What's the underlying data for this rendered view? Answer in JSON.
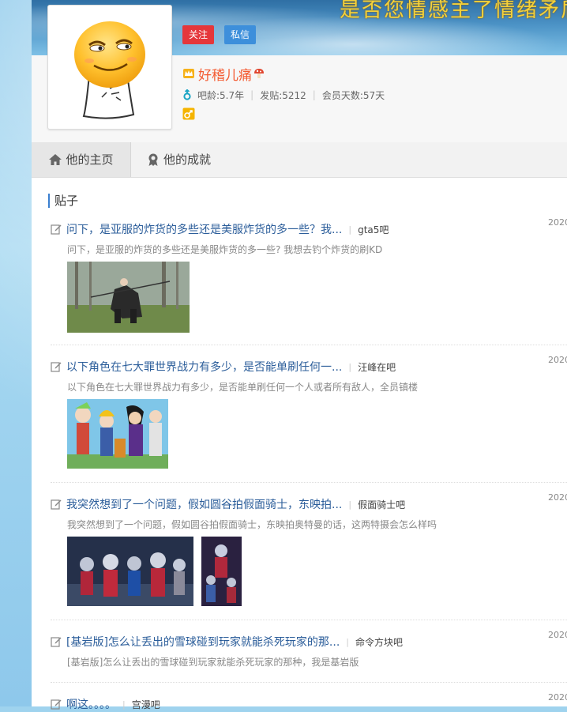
{
  "header": {
    "slogan": "是否您情感主了情绪矛盾"
  },
  "profile": {
    "follow_label": "关注",
    "message_label": "私信",
    "username": "好稽儿痛",
    "stats": {
      "age": "吧龄:5.7年",
      "posts": "发贴:5212",
      "member_days": "会员天数:57天"
    }
  },
  "tabs": [
    {
      "label": "他的主页",
      "icon": "home-icon"
    },
    {
      "label": "他的成就",
      "icon": "medal-icon"
    }
  ],
  "section": {
    "title": "贴子"
  },
  "posts": [
    {
      "title": "问下，是亚服的炸货的多些还是美服炸货的多一些？我...",
      "forum": "gta5吧",
      "date": "2020",
      "desc": "问下，是亚服的炸货的多些还是美服炸货的多一些? 我想去钓个炸货的刷KD"
    },
    {
      "title": "以下角色在七大罪世界战力有多少，是否能单刷任何一...",
      "forum": "汪峰在吧",
      "date": "2020",
      "desc": "以下角色在七大罪世界战力有多少，是否能单刷任何一个人或者所有敌人，全员镇楼"
    },
    {
      "title": "我突然想到了一个问题，假如圆谷拍假面骑士，东映拍...",
      "forum": "假面骑士吧",
      "date": "2020",
      "desc": "我突然想到了一个问题，假如圆谷拍假面骑士，东映拍奥特曼的话，这两特摄会怎么样吗"
    },
    {
      "title": "[基岩版]怎么让丢出的雪球碰到玩家就能杀死玩家的那...",
      "forum": "命令方块吧",
      "date": "2020",
      "desc": "[基岩版]怎么让丢出的雪球碰到玩家就能杀死玩家的那种，我是基岩版"
    },
    {
      "title": "啊这。。。。",
      "forum": "宫漫吧",
      "date": "2020",
      "desc": ""
    }
  ],
  "colors": {
    "follow": "#e5373b",
    "message": "#3d8fdb",
    "username": "#f45b32",
    "link": "#2b5d9a"
  }
}
